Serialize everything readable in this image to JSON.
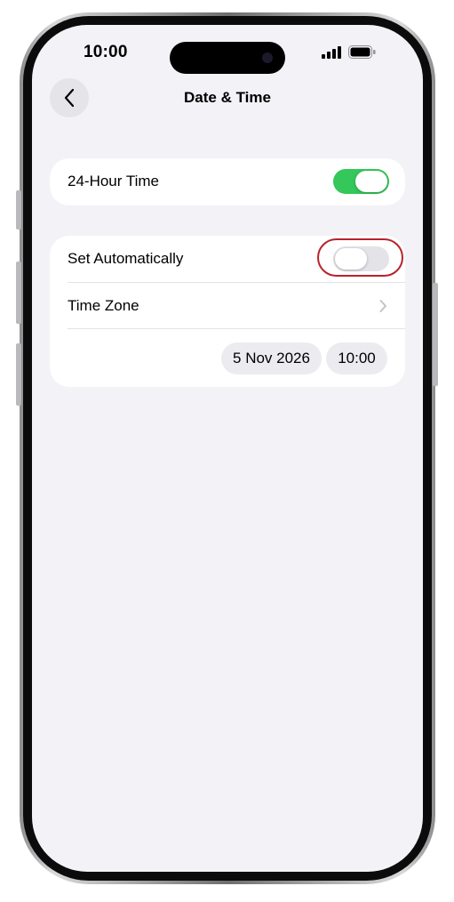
{
  "status_bar": {
    "time": "10:00"
  },
  "header": {
    "title": "Date & Time",
    "back_icon": "chevron-left-icon"
  },
  "settings": {
    "hour_24": {
      "label": "24-Hour Time",
      "enabled": true
    },
    "set_automatically": {
      "label": "Set Automatically",
      "enabled": false,
      "highlighted": true
    },
    "time_zone": {
      "label": "Time Zone",
      "icon": "chevron-right-icon"
    },
    "date_value": "5 Nov 2026",
    "time_value": "10:00"
  },
  "colors": {
    "toggle_on": "#34c759",
    "toggle_off": "#e3e3e8",
    "highlight": "#b8232b",
    "background": "#f2f2f7"
  }
}
